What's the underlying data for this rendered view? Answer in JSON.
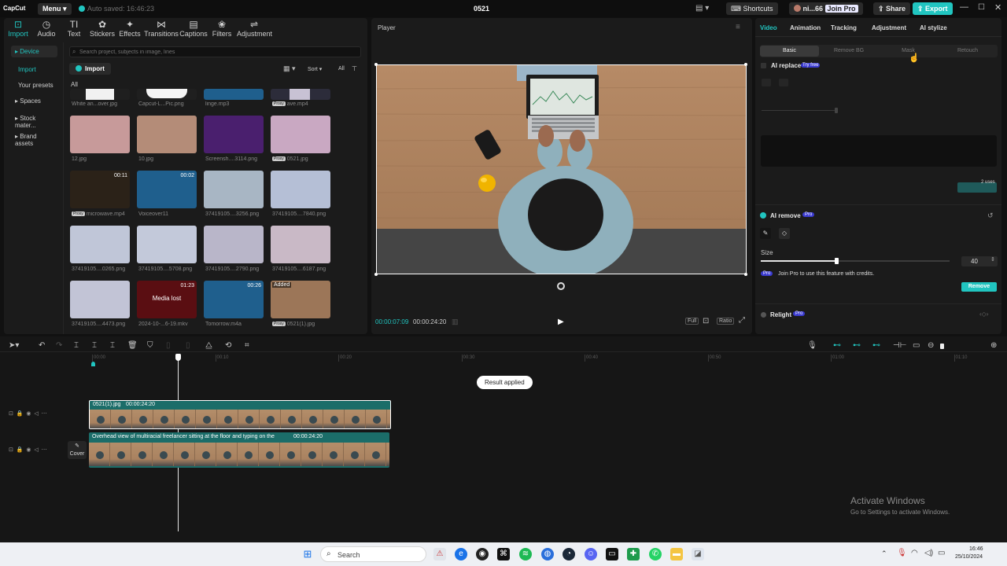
{
  "titlebar": {
    "app_name": "CapCut",
    "menu_label": "Menu",
    "autosave": "Auto saved: 16:46:23",
    "project_title": "0521",
    "shortcuts_label": "Shortcuts",
    "user_name": "ni...66",
    "join_pro_label": "Join Pro",
    "share_label": "Share",
    "export_label": "Export"
  },
  "toolbar": [
    {
      "label": "Import",
      "icon": "import-icon",
      "glyph": "⊡"
    },
    {
      "label": "Audio",
      "icon": "audio-icon",
      "glyph": "◷"
    },
    {
      "label": "Text",
      "icon": "text-icon",
      "glyph": "TI"
    },
    {
      "label": "Stickers",
      "icon": "stickers-icon",
      "glyph": "✿"
    },
    {
      "label": "Effects",
      "icon": "effects-icon",
      "glyph": "✦"
    },
    {
      "label": "Transitions",
      "icon": "transitions-icon",
      "glyph": "⋈"
    },
    {
      "label": "Captions",
      "icon": "captions-icon",
      "glyph": "▤"
    },
    {
      "label": "Filters",
      "icon": "filters-icon",
      "glyph": "❀"
    },
    {
      "label": "Adjustment",
      "icon": "adjustment-icon",
      "glyph": "⇌"
    }
  ],
  "sidebar": {
    "items": [
      {
        "label": "▸ Device"
      },
      {
        "label": "Import"
      },
      {
        "label": "Your presets"
      },
      {
        "label": "▸ Spaces"
      },
      {
        "label": "▸ Stock mater..."
      },
      {
        "label": "▸ Brand assets"
      }
    ]
  },
  "media": {
    "search_placeholder": "Search project, subjects in image, lines",
    "import_label": "Import",
    "sort_label": "Sort",
    "all_filter_label": "All",
    "all_heading": "All",
    "row0": [
      {
        "name": "White an...over.jpg"
      },
      {
        "name": "Capcut-L...Pic.png"
      },
      {
        "name": "linge.mp3"
      },
      {
        "name": "ave.mp4",
        "proxy": "Proxy"
      }
    ],
    "items": [
      {
        "name": "12.jpg",
        "bg": "#c79a9a",
        "dur": "",
        "proxy": ""
      },
      {
        "name": "10.jpg",
        "bg": "#b48c78",
        "dur": "",
        "proxy": ""
      },
      {
        "name": "Screensh....3114.png",
        "bg": "#4a1f6e",
        "dur": "",
        "proxy": ""
      },
      {
        "name": "0521.jpg",
        "bg": "#c9a8c2",
        "dur": "",
        "proxy": "Proxy"
      },
      {
        "name": "microwave.mp4",
        "bg": "#2b2218",
        "dur": "00:11",
        "proxy": "Proxy"
      },
      {
        "name": "Voiceover11",
        "bg": "#1f5f8d",
        "dur": "00:02",
        "proxy": ""
      },
      {
        "name": "37419105....3256.png",
        "bg": "#a8b6c4",
        "dur": "",
        "proxy": ""
      },
      {
        "name": "37419105....7840.png",
        "bg": "#b5bfd6",
        "dur": "",
        "proxy": ""
      },
      {
        "name": "37419105....0265.png",
        "bg": "#c0c6d8",
        "dur": "",
        "proxy": ""
      },
      {
        "name": "37419105....5708.png",
        "bg": "#c3c9da",
        "dur": "",
        "proxy": ""
      },
      {
        "name": "37419105....2790.png",
        "bg": "#b9b6c9",
        "dur": "",
        "proxy": ""
      },
      {
        "name": "37419105....6187.png",
        "bg": "#c9b9c6",
        "dur": "",
        "proxy": ""
      },
      {
        "name": "37419105....4473.png",
        "bg": "#c2c4d6",
        "dur": "",
        "proxy": ""
      },
      {
        "name": "2024-10-...6-19.mkv",
        "bg": "#5a0e12",
        "dur": "01:23",
        "proxy": "",
        "center": "Media lost"
      },
      {
        "name": "Tomorrow.m4a",
        "bg": "#1f5f8d",
        "dur": "00:26",
        "proxy": ""
      },
      {
        "name": "0521(1).jpg",
        "bg": "#9c7658",
        "dur": "",
        "proxy": "Proxy",
        "added": "Added"
      }
    ]
  },
  "player": {
    "title": "Player",
    "current_time": "00:00:07:09",
    "total_time": "00:00:24:20",
    "full_label": "Full",
    "ratio_label": "Ratio"
  },
  "inspector": {
    "tabs": [
      "Video",
      "Animation",
      "Tracking",
      "Adjustment",
      "AI stylize"
    ],
    "subtabs": [
      "Basic",
      "Remove BG",
      "Mask",
      "Retouch"
    ],
    "ai_replace_label": "AI replace",
    "try_free_badge": "Try free",
    "uses_label": "2 uses",
    "ai_remove_label": "AI remove",
    "pro_badge": "Pro",
    "size_label": "Size",
    "size_value": "40",
    "size_fraction": 0.4,
    "join_pro_text": "Join Pro to use this feature with credits.",
    "remove_label": "Remove",
    "relight_label": "Relight"
  },
  "timeline": {
    "ruler": [
      "00:00",
      "00:10",
      "00:20",
      "00:30",
      "00:40",
      "00:50",
      "01:00",
      "01:10"
    ],
    "toast": "Result applied",
    "clip1_name": "0521(1).jpg",
    "clip1_duration": "00:00:24:20",
    "clip2_name": "Overhead view of multiracial freelancer sitting at the floor and typing on the",
    "clip2_duration": "00:00:24:20",
    "cover_label": "Cover"
  },
  "watermark": {
    "title": "Activate Windows",
    "subtitle": "Go to Settings to activate Windows."
  },
  "taskbar": {
    "search_placeholder": "Search",
    "time": "16:46",
    "date": "25/10/2024"
  }
}
